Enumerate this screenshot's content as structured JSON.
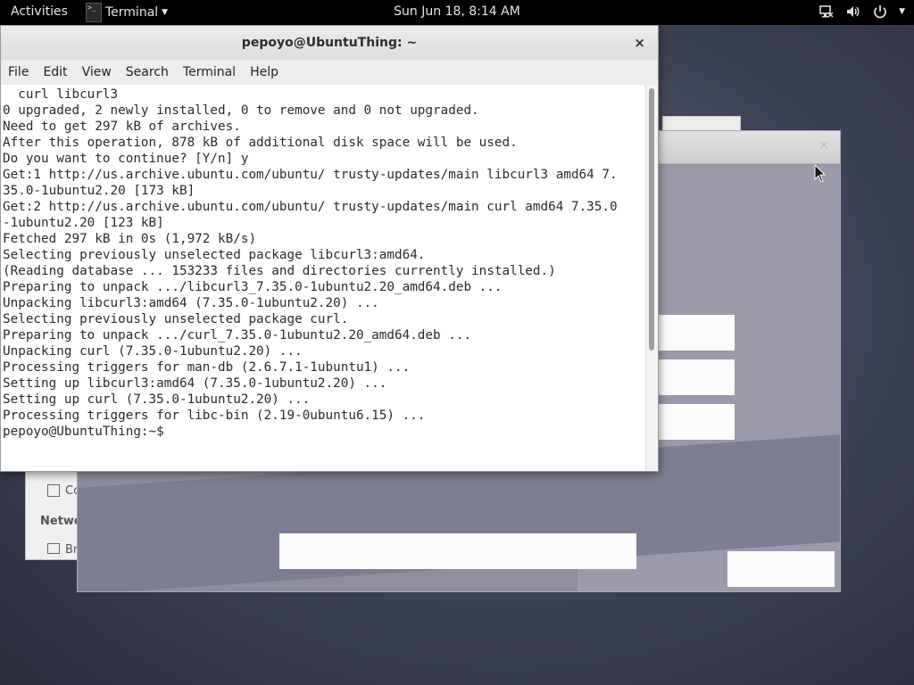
{
  "topbar": {
    "activities": "Activities",
    "app_name": "Terminal",
    "clock": "Sun Jun 18,  8:14 AM",
    "tray_icons": [
      "network-icon",
      "volume-icon",
      "power-icon",
      "chevron-down-icon"
    ]
  },
  "background": {
    "panel_rows": [
      "Co",
      "Netwo",
      "Br"
    ]
  },
  "terminal": {
    "title": "pepoyo@UbuntuThing: ~",
    "close": "×",
    "menu": [
      "File",
      "Edit",
      "View",
      "Search",
      "Terminal",
      "Help"
    ],
    "lines": [
      "  curl libcurl3",
      "0 upgraded, 2 newly installed, 0 to remove and 0 not upgraded.",
      "Need to get 297 kB of archives.",
      "After this operation, 878 kB of additional disk space will be used.",
      "Do you want to continue? [Y/n] y",
      "Get:1 http://us.archive.ubuntu.com/ubuntu/ trusty-updates/main libcurl3 amd64 7.",
      "35.0-1ubuntu2.20 [173 kB]",
      "Get:2 http://us.archive.ubuntu.com/ubuntu/ trusty-updates/main curl amd64 7.35.0",
      "-1ubuntu2.20 [123 kB]",
      "Fetched 297 kB in 0s (1,972 kB/s)",
      "Selecting previously unselected package libcurl3:amd64.",
      "(Reading database ... 153233 files and directories currently installed.)",
      "Preparing to unpack .../libcurl3_7.35.0-1ubuntu2.20_amd64.deb ...",
      "Unpacking libcurl3:amd64 (7.35.0-1ubuntu2.20) ...",
      "Selecting previously unselected package curl.",
      "Preparing to unpack .../curl_7.35.0-1ubuntu2.20_amd64.deb ...",
      "Unpacking curl (7.35.0-1ubuntu2.20) ...",
      "Processing triggers for man-db (2.6.7.1-1ubuntu1) ...",
      "Setting up libcurl3:amd64 (7.35.0-1ubuntu2.20) ...",
      "Setting up curl (7.35.0-1ubuntu2.20) ...",
      "Processing triggers for libc-bin (2.19-0ubuntu6.15) ...",
      "pepoyo@UbuntuThing:~$ "
    ]
  },
  "colors": {
    "topbar_bg": "#000000",
    "terminal_bg": "#ffffff",
    "terminal_text": "#2b2b2b",
    "desktop_bg": "#3d4156"
  }
}
